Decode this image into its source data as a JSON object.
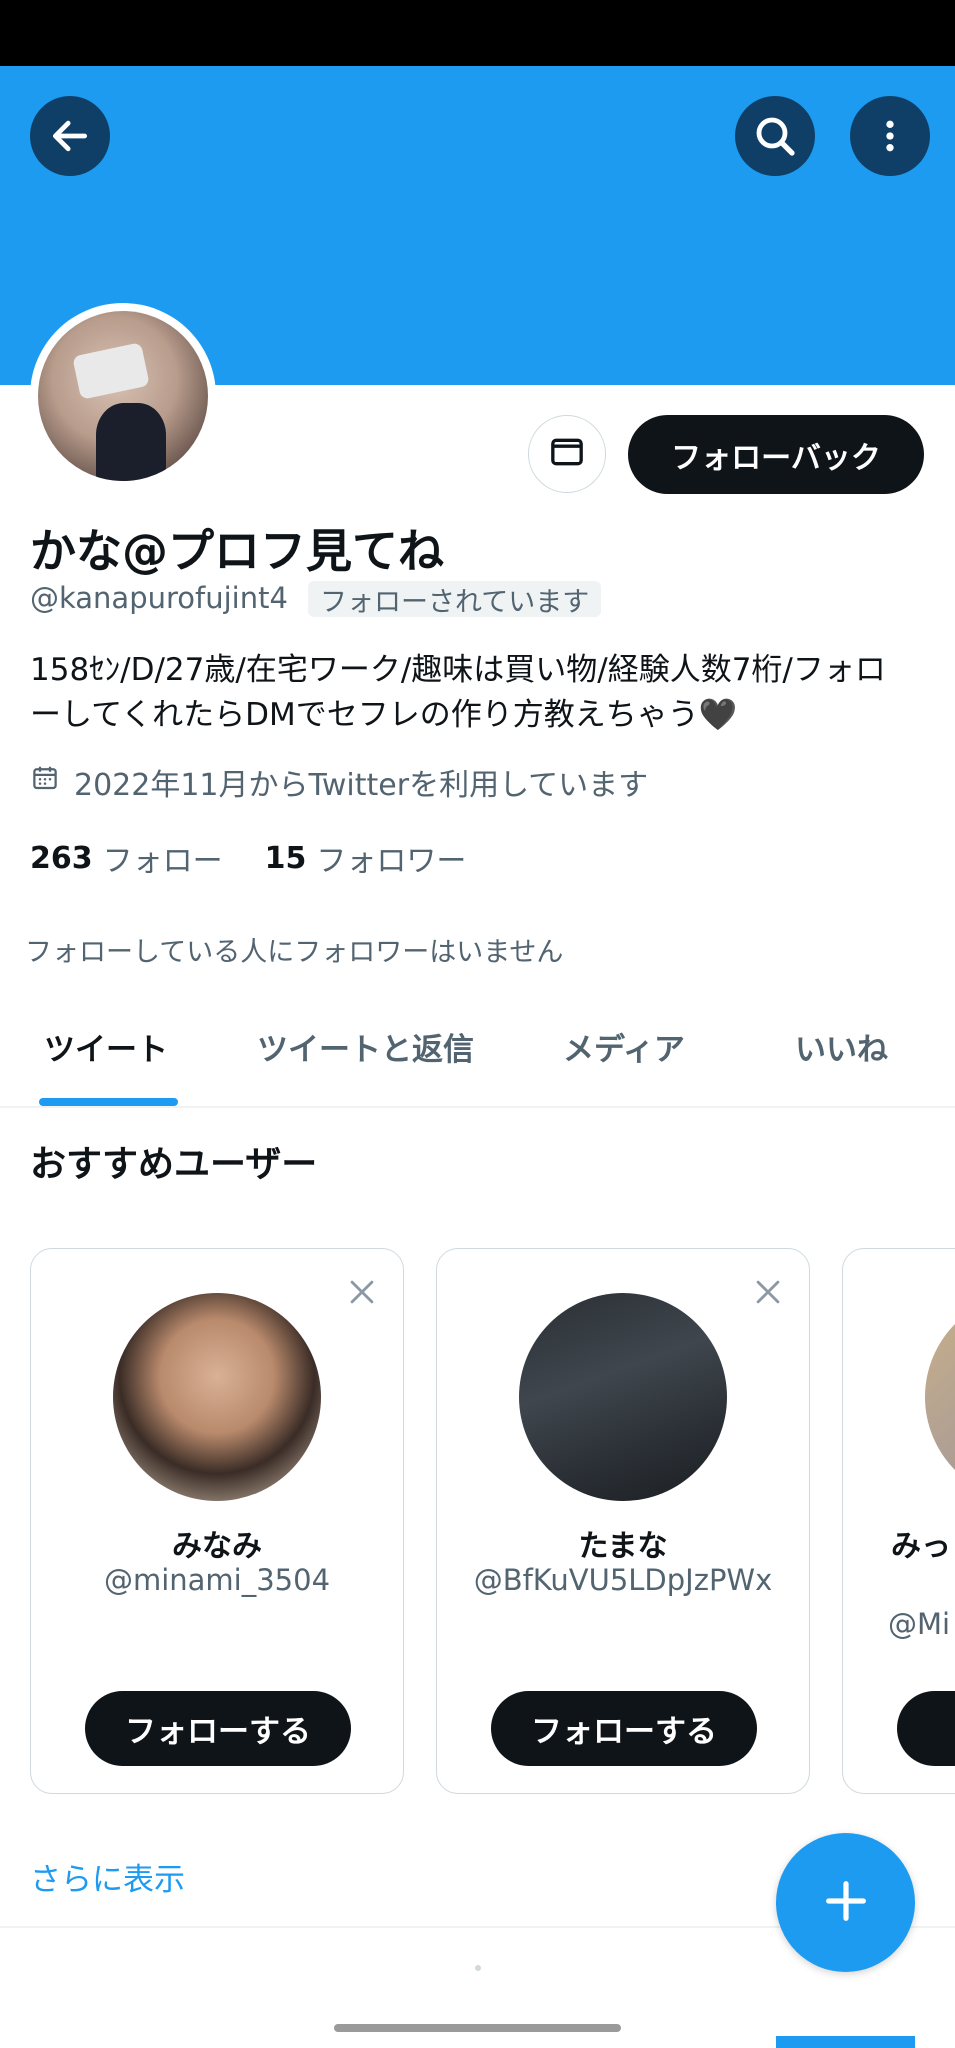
{
  "header": {
    "back_icon": "arrow-left-icon",
    "search_icon": "search-icon",
    "more_icon": "more-vertical-icon",
    "banner_color": "#1d9bf0"
  },
  "profile": {
    "display_name": "かな@プロフ見てね",
    "handle": "@kanapurofujint4",
    "follows_you_badge": "フォローされています",
    "bio": "158ｾﾝ/D/27歳/在宅ワーク/趣味は買い物/経験人数7桁/フォローしてくれたらDMでセフレの作り方教えちゃう🖤",
    "joined": "2022年11月からTwitterを利用しています",
    "following_count": "263",
    "following_label": "フォロー",
    "followers_count": "15",
    "followers_label": "フォロワー",
    "no_mutual_followers": "フォローしている人にフォロワーはいません",
    "follow_back_label": "フォローバック",
    "message_icon": "mail-icon"
  },
  "tabs": [
    {
      "label": "ツイート",
      "active": true
    },
    {
      "label": "ツイートと返信",
      "active": false
    },
    {
      "label": "メディア",
      "active": false
    },
    {
      "label": "いいね",
      "active": false
    }
  ],
  "recommended": {
    "title": "おすすめユーザー",
    "users": [
      {
        "name": "みなみ",
        "handle": "@minami_3504",
        "follow_label": "フォローする"
      },
      {
        "name": "たまな",
        "handle": "@BfKuVU5LDpJzPWx",
        "follow_label": "フォローする"
      },
      {
        "name": "みっ",
        "handle": "@Mi",
        "follow_label": "フ"
      }
    ],
    "show_more": "さらに表示"
  },
  "fab": {
    "icon": "plus-icon"
  },
  "colors": {
    "accent": "#1d9bf0",
    "text": "#0f1419",
    "secondary": "#536471",
    "button_dark": "#0f1419"
  }
}
